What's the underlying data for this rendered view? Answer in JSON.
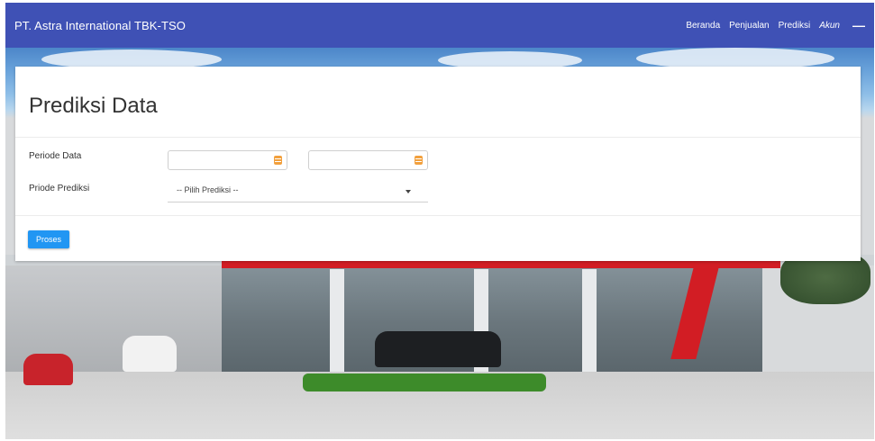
{
  "navbar": {
    "brand": "PT. Astra International TBK-TSO",
    "links": [
      {
        "label": "Beranda"
      },
      {
        "label": "Penjualan"
      },
      {
        "label": "Prediksi"
      },
      {
        "label": "Akun"
      }
    ],
    "account_icon": "minus-icon"
  },
  "form": {
    "title": "Prediksi Data",
    "periode_label": "Periode Data",
    "date_start_value": "",
    "date_end_value": "",
    "date_icon": "calendar-icon",
    "prediksi_label": "Priode Prediksi",
    "prediksi_selected": "-- Pilih Prediksi --",
    "prediksi_icon": "caret-down-icon",
    "submit_label": "Proses"
  },
  "colors": {
    "navbar": "#3f51b5",
    "button": "#2196f3",
    "calendar_icon": "#f2a03d",
    "accent_red": "#d21d24"
  }
}
